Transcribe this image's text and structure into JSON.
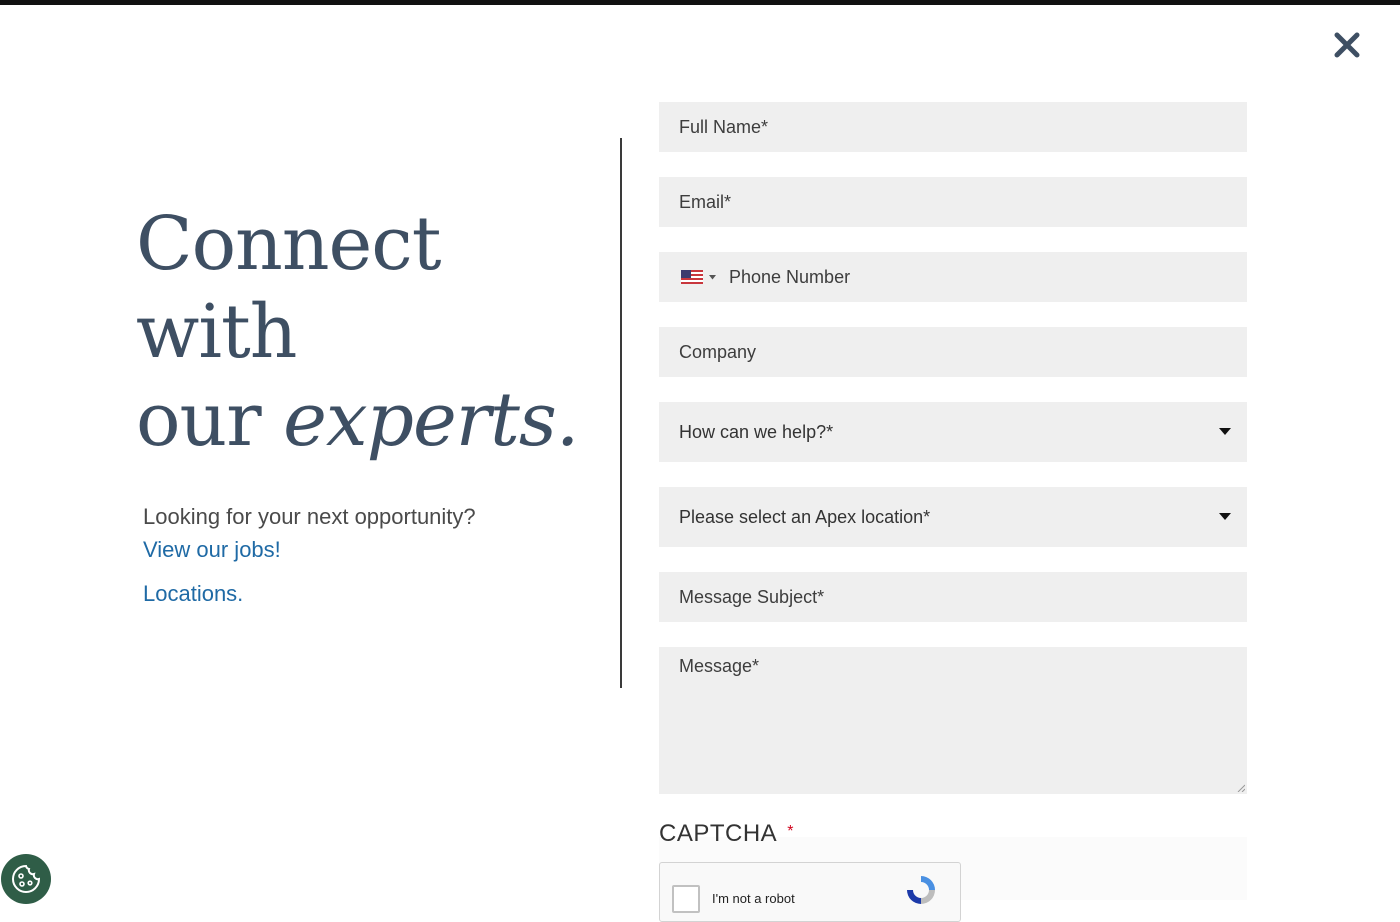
{
  "hero": {
    "line1": "Connect",
    "line2": "with",
    "line3_plain": "our ",
    "line3_emph": "experts."
  },
  "intro": {
    "question": "Looking for your next opportunity?",
    "jobs_link": "View our jobs!",
    "locations_link": "Locations."
  },
  "form": {
    "full_name": {
      "placeholder": "Full Name*",
      "value": ""
    },
    "email": {
      "placeholder": "Email*",
      "value": ""
    },
    "phone": {
      "placeholder": "Phone Number",
      "value": "",
      "country_icon": "us-flag-icon"
    },
    "company": {
      "placeholder": "Company",
      "value": ""
    },
    "help_select": {
      "selected": "How can we help?*"
    },
    "location_select": {
      "selected": "Please select an Apex location*"
    },
    "subject": {
      "placeholder": "Message Subject*",
      "value": ""
    },
    "message": {
      "placeholder": "Message*",
      "value": ""
    }
  },
  "captcha": {
    "label": "CAPTCHA",
    "required_mark": "*",
    "checkbox_text": "I'm not a robot"
  },
  "icons": {
    "close": "close-icon",
    "cookie": "cookie-icon",
    "caret": "chevron-down-icon",
    "recaptcha": "recaptcha-logo-icon"
  },
  "colors": {
    "heading": "#3e4f63",
    "link": "#1f6aa5",
    "field_bg": "#efefef",
    "cookie_bg": "#2f5d47",
    "required": "#d0021b"
  }
}
